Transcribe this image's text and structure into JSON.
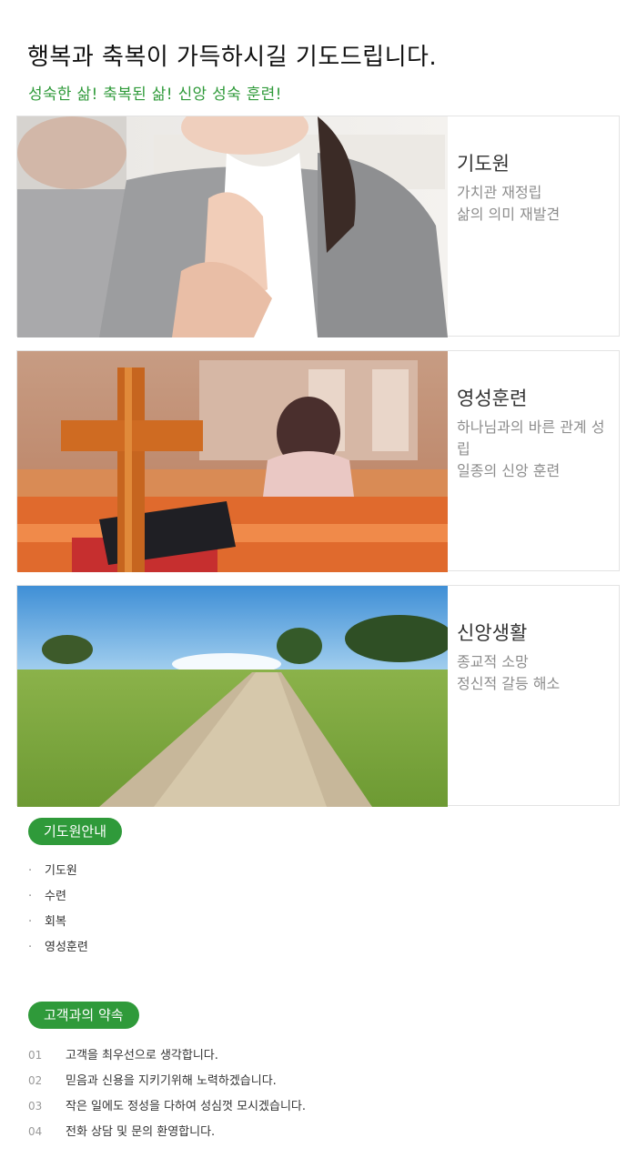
{
  "headline": "행복과 축복이 가득하시길 기도드립니다.",
  "subhead": "성숙한 삶! 축복된 삶! 신앙 성숙 훈련!",
  "cards": [
    {
      "title": "기도원",
      "lines": [
        "가치관 재정립",
        "삶의 의미 재발견"
      ]
    },
    {
      "title": "영성훈련",
      "lines": [
        "하나님과의 바른 관계 성",
        "립",
        "일종의 신앙 훈련"
      ]
    },
    {
      "title": "신앙생활",
      "lines": [
        "종교적 소망",
        "정신적 갈등 해소"
      ]
    }
  ],
  "guide": {
    "label": "기도원안내",
    "items": [
      "기도원",
      "수련",
      "회복",
      "영성훈련"
    ]
  },
  "promise": {
    "label": "고객과의 약속",
    "items": [
      {
        "num": "01",
        "text": "고객을 최우선으로 생각합니다."
      },
      {
        "num": "02",
        "text": "믿음과 신용을 지키기위해 노력하겠습니다."
      },
      {
        "num": "03",
        "text": "작은 일에도 정성을 다하여 성심껏 모시겠습니다."
      },
      {
        "num": "04",
        "text": "전화 상담 및 문의 환영합니다."
      }
    ]
  },
  "colors": {
    "accent": "#2f9a3a"
  }
}
